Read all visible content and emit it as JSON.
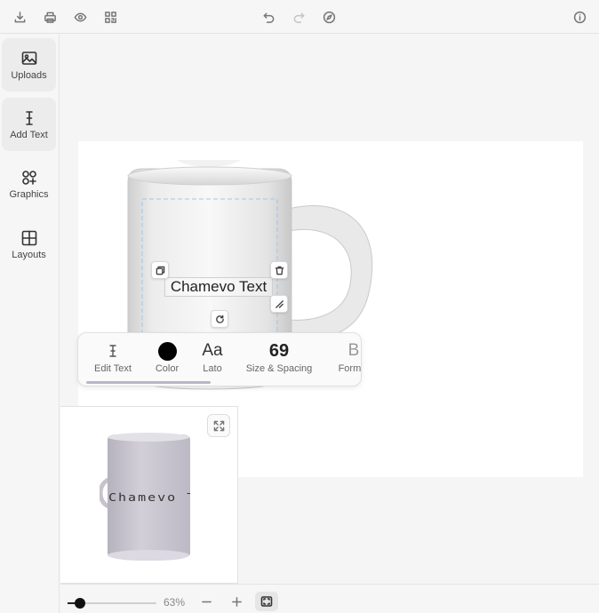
{
  "toolbar": {
    "icons": [
      "download-icon",
      "print-icon",
      "preview-eye-icon",
      "qr-code-icon",
      "undo-icon",
      "redo-icon",
      "compass-icon",
      "info-icon"
    ]
  },
  "sidebar": {
    "items": [
      {
        "label": "Uploads",
        "icon": "image-upload-icon"
      },
      {
        "label": "Add Text",
        "icon": "text-cursor-icon"
      },
      {
        "label": "Graphics",
        "icon": "shapes-icon"
      },
      {
        "label": "Layouts",
        "icon": "grid-layout-icon"
      }
    ]
  },
  "design": {
    "text": "Chamevo Text"
  },
  "text_toolbar": {
    "edit_text": "Edit Text",
    "color_label": "Color",
    "color_value": "#000000",
    "font_preview": "Aa",
    "font_name": "Lato",
    "size_value": "69",
    "size_label": "Size & Spacing",
    "format_icon": "B",
    "format_label": "Format"
  },
  "preview": {
    "text": "Chamevo Text"
  },
  "zoom": {
    "value": "63%",
    "level": 0.63
  },
  "colors": {
    "selection_dash": "#9cc8ee",
    "accent": "#111111"
  }
}
